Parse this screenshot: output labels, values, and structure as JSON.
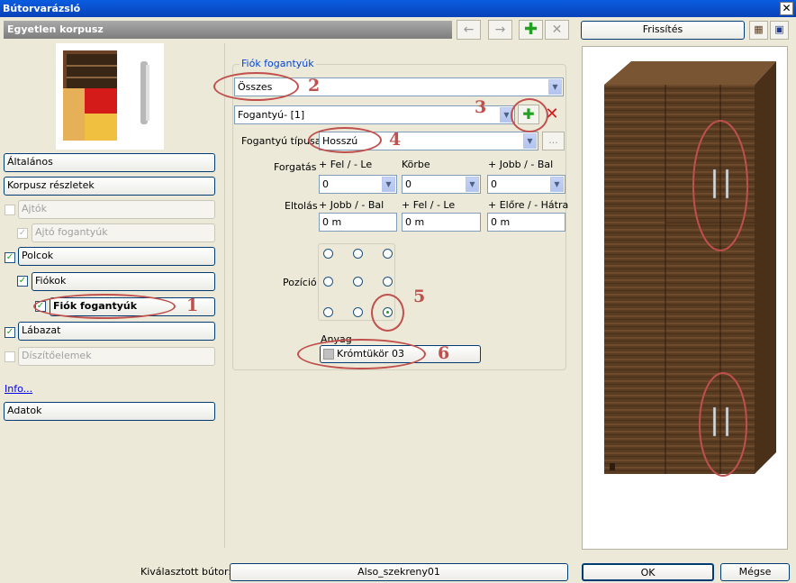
{
  "window": {
    "title": "Bútorvarázsló",
    "close_glyph": "✕"
  },
  "section": {
    "title": "Egyetlen korpusz"
  },
  "nav": {
    "items": [
      {
        "label": "Általános"
      },
      {
        "label": "Korpusz részletek"
      },
      {
        "label": "Ajtók",
        "checked": false,
        "enabled": false
      },
      {
        "label": "Ajtó fogantyúk",
        "checked": true,
        "enabled": false
      },
      {
        "label": "Polcok",
        "checked": true,
        "enabled": true
      },
      {
        "label": "Fiókok",
        "checked": true,
        "enabled": true
      },
      {
        "label": "Fiók fogantyúk",
        "checked": true,
        "enabled": true,
        "selected": true
      },
      {
        "label": "Lábazat",
        "checked": true,
        "enabled": true
      },
      {
        "label": "Díszítőelemek",
        "checked": false,
        "enabled": false
      }
    ],
    "info_link": "Info...",
    "data_button": "Adatok"
  },
  "handles": {
    "group_title": "Fiók fogantyúk",
    "filter_value": "Összes",
    "handle_select": "Fogantyú- [1]",
    "type_label": "Fogantyú típusa",
    "type_value": "Hosszú",
    "more_button": "...",
    "rotation": {
      "label": "Forgatás",
      "headers": [
        "+ Fel / - Le",
        "Körbe",
        "+ Jobb / - Bal"
      ],
      "values": [
        "0",
        "0",
        "0"
      ]
    },
    "offset": {
      "label": "Eltolás",
      "headers": [
        "+ Jobb / - Bal",
        "+ Fel / - Le",
        "+ Előre / - Hátra"
      ],
      "values": [
        "0 m",
        "0 m",
        "0 m"
      ]
    },
    "position": {
      "label": "Pozíció",
      "selected_index": 8
    },
    "material": {
      "label": "Anyag",
      "value": "Krómtükör 03"
    }
  },
  "annotations": [
    "1",
    "2",
    "3",
    "4",
    "5",
    "6"
  ],
  "preview": {
    "refresh_button": "Frissítés"
  },
  "status": {
    "selected_label": "Kiválasztott bútor:",
    "selected_value": "Also_szekreny01",
    "ok": "OK",
    "cancel": "Mégse"
  },
  "colors": {
    "title_bar": "#0a5de0",
    "annotation": "#c0504d",
    "add_green": "#21a121",
    "remove_red": "#d11a1a",
    "wood": "#5a3c22"
  }
}
